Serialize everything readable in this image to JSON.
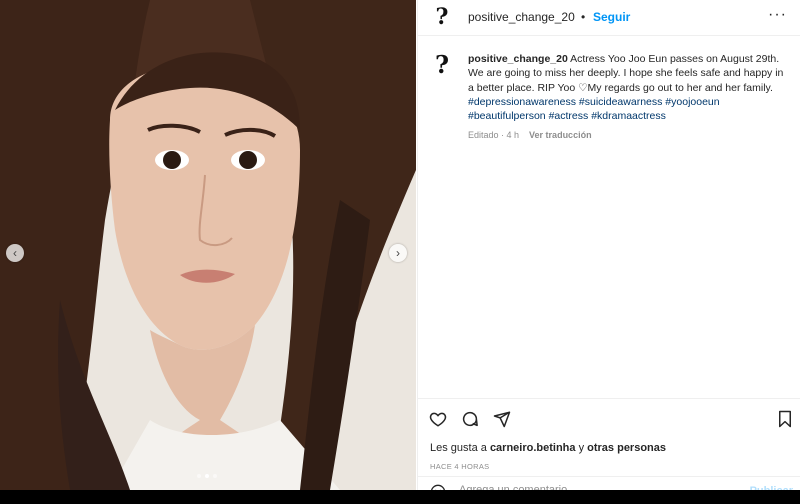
{
  "post": {
    "username": "positive_change_20",
    "separator": "•",
    "follow_label": "Seguir",
    "more_label": "···",
    "avatar_glyph": "?",
    "caption": {
      "username": "positive_change_20",
      "text": " Actress Yoo Joo Eun passes on August 29th. We are going to miss her deeply. I hope she feels safe and happy in a better place. RIP Yoo ♡My regards go out to her and her family. ",
      "hashtags": [
        "#depressionawareness",
        "#suicideawarness",
        "#yoojooeun",
        "#beautifulperson",
        "#actress",
        "#kdramaactress"
      ]
    },
    "meta_time": "Editado · 4 h",
    "translate_label": "Ver traducción",
    "likes": {
      "prefix": "Les gusta a ",
      "user": "carneiro.betinha",
      "connector": " y ",
      "others": "otras personas"
    },
    "posted_time": "HACE 4 HORAS",
    "comment": {
      "placeholder": "Agrega un comentario...",
      "publish_label": "Publicar"
    },
    "carousel": {
      "prev_icon": "‹",
      "next_icon": "›",
      "dots": 3,
      "active_dot": 1
    }
  },
  "colors": {
    "follow": "#0095f6",
    "hashtag": "#00376b",
    "publish_disabled": "#b2dffc",
    "meta": "#8e8e8e"
  },
  "icons": [
    "heart-icon",
    "comment-icon",
    "share-icon",
    "bookmark-icon",
    "emoji-icon",
    "chevron-left-icon",
    "chevron-right-icon"
  ]
}
